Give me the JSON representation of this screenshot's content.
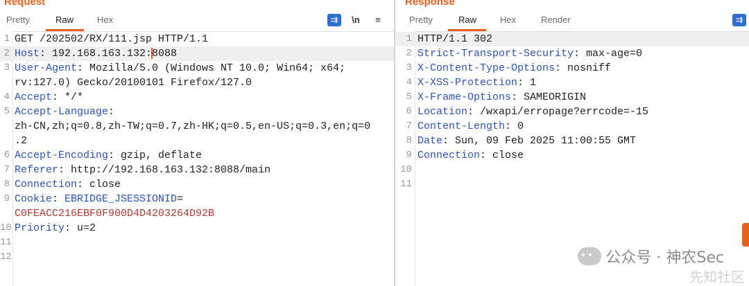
{
  "request": {
    "title": "Request",
    "tabs": [
      "Pretty",
      "Raw",
      "Hex"
    ],
    "active_tab": "Raw",
    "tools": {
      "wrap": "⇉",
      "newline": "\\n",
      "menu": "≡"
    },
    "lines": [
      {
        "n": "1",
        "parts": [
          {
            "t": "GET /202502/RX/111.jsp HTTP/1.1",
            "c": "v"
          }
        ]
      },
      {
        "n": "2",
        "hl": true,
        "parts": [
          {
            "t": "Host",
            "c": "k"
          },
          {
            "t": ": 192.168.163.132:",
            "c": "v"
          },
          {
            "caret": true
          },
          {
            "t": "8088",
            "c": "v"
          }
        ]
      },
      {
        "n": "3",
        "parts": [
          {
            "t": "User-Agent",
            "c": "k"
          },
          {
            "t": ": Mozilla/5.0 (Windows NT 10.0; Win64; x64;",
            "c": "v"
          }
        ]
      },
      {
        "n": "",
        "parts": [
          {
            "t": "rv:127.0) Gecko/20100101 Firefox/127.0",
            "c": "v"
          }
        ]
      },
      {
        "n": "4",
        "parts": [
          {
            "t": "Accept",
            "c": "k"
          },
          {
            "t": ": */*",
            "c": "v"
          }
        ]
      },
      {
        "n": "5",
        "parts": [
          {
            "t": "Accept-Language",
            "c": "k"
          },
          {
            "t": ":",
            "c": "v"
          }
        ]
      },
      {
        "n": "",
        "parts": [
          {
            "t": "zh-CN,zh;q=0.8,zh-TW;q=0.7,zh-HK;q=0.5,en-US;q=0.3,en;q=0",
            "c": "v"
          }
        ]
      },
      {
        "n": "",
        "parts": [
          {
            "t": ".2",
            "c": "v"
          }
        ]
      },
      {
        "n": "6",
        "parts": [
          {
            "t": "Accept-Encoding",
            "c": "k"
          },
          {
            "t": ": gzip, deflate",
            "c": "v"
          }
        ]
      },
      {
        "n": "7",
        "parts": [
          {
            "t": "Referer",
            "c": "k"
          },
          {
            "t": ": http://192.168.163.132:8088/main",
            "c": "v"
          }
        ]
      },
      {
        "n": "8",
        "parts": [
          {
            "t": "Connection",
            "c": "k"
          },
          {
            "t": ": close",
            "c": "v"
          }
        ]
      },
      {
        "n": "9",
        "parts": [
          {
            "t": "Cookie",
            "c": "k"
          },
          {
            "t": ": ",
            "c": "v"
          },
          {
            "t": "EBRIDGE_JSESSIONID",
            "c": "k"
          },
          {
            "t": "=",
            "c": "v"
          }
        ]
      },
      {
        "n": "",
        "parts": [
          {
            "t": "C0FEACC216EBF0F900D4D4203264D92B",
            "c": "ck"
          }
        ]
      },
      {
        "n": "10",
        "parts": [
          {
            "t": "Priority",
            "c": "k"
          },
          {
            "t": ": u=2",
            "c": "v"
          }
        ]
      },
      {
        "n": "11",
        "parts": []
      },
      {
        "n": "12",
        "parts": []
      }
    ]
  },
  "response": {
    "title": "Response",
    "tabs": [
      "Pretty",
      "Raw",
      "Hex",
      "Render"
    ],
    "active_tab": "Raw",
    "tools": {
      "wrap": "⇉"
    },
    "lines": [
      {
        "n": "1",
        "hl": true,
        "parts": [
          {
            "t": "HTTP/1.1 302",
            "c": "v"
          }
        ]
      },
      {
        "n": "2",
        "parts": [
          {
            "t": "Strict-Transport-Security",
            "c": "k"
          },
          {
            "t": ": max-age=0",
            "c": "v"
          }
        ]
      },
      {
        "n": "3",
        "parts": [
          {
            "t": "X-Content-Type-Options",
            "c": "k"
          },
          {
            "t": ": nosniff",
            "c": "v"
          }
        ]
      },
      {
        "n": "4",
        "parts": [
          {
            "t": "X-XSS-Protection",
            "c": "k"
          },
          {
            "t": ": 1",
            "c": "v"
          }
        ]
      },
      {
        "n": "5",
        "parts": [
          {
            "t": "X-Frame-Options",
            "c": "k"
          },
          {
            "t": ": SAMEORIGIN",
            "c": "v"
          }
        ]
      },
      {
        "n": "6",
        "parts": [
          {
            "t": "Location",
            "c": "k"
          },
          {
            "t": ": /wxapi/erropage?errcode=-15",
            "c": "v"
          }
        ]
      },
      {
        "n": "7",
        "parts": [
          {
            "t": "Content-Length",
            "c": "k"
          },
          {
            "t": ": 0",
            "c": "v"
          }
        ]
      },
      {
        "n": "8",
        "parts": [
          {
            "t": "Date",
            "c": "k"
          },
          {
            "t": ": Sun, 09 Feb 2025 11:00:55 GMT",
            "c": "v"
          }
        ]
      },
      {
        "n": "9",
        "parts": [
          {
            "t": "Connection",
            "c": "k"
          },
          {
            "t": ": close",
            "c": "v"
          }
        ]
      },
      {
        "n": "10",
        "parts": []
      },
      {
        "n": "11",
        "parts": []
      }
    ]
  },
  "watermark": {
    "text": "公众号 · 神农Sec",
    "secondary": "先知社区"
  },
  "colors": {
    "accent": "#e8601c",
    "key": "#2a53b9",
    "cookie_value": "#b03a2e",
    "wrap_button": "#2b6fd6"
  }
}
